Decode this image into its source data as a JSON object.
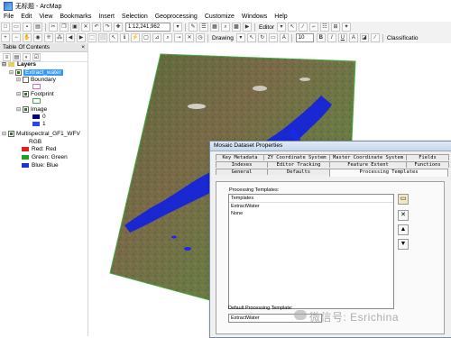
{
  "window": {
    "title": "无标题 - ArcMap"
  },
  "menu": [
    "File",
    "Edit",
    "View",
    "Bookmarks",
    "Insert",
    "Selection",
    "Geoprocessing",
    "Customize",
    "Windows",
    "Help"
  ],
  "toolbar": {
    "scale": "1:12,241,962",
    "editor_label": "Editor",
    "drawing_label": "Drawing",
    "font_size": "10",
    "bold": "B",
    "italic": "I",
    "underline": "U",
    "classification_label": "Classificatio"
  },
  "toc": {
    "title": "Table Of Contents",
    "close": "×",
    "root": "Layers",
    "layers": [
      {
        "label": "Extract_water",
        "selected": true
      },
      {
        "label": "Boundary"
      },
      {
        "label": "Footprint"
      },
      {
        "label": "Image"
      },
      {
        "label": "0"
      },
      {
        "label": "1"
      },
      {
        "label": "Multispectral_GF1_WFV"
      },
      {
        "label": "RGB"
      },
      {
        "label": "Red:  Red"
      },
      {
        "label": "Green: Green"
      },
      {
        "label": "Blue:  Blue"
      }
    ],
    "colors": {
      "boundary": "#d070d0",
      "footprint": "#40b040",
      "image0": "#000080",
      "image1": "#3040ff",
      "red": "#e02020",
      "green": "#20a020",
      "blue": "#2030e0"
    }
  },
  "dialog": {
    "title": "Mosaic Dataset Properties",
    "tabs_row1": [
      "Key Metadata",
      "ZY Coordinate System",
      "Master Coordinate System",
      "Fields"
    ],
    "tabs_row2": [
      "Indexes",
      "Editor Tracking",
      "Feature Extent",
      "Functions"
    ],
    "tabs_row3": [
      "General",
      "Defaults",
      "Processing Templates"
    ],
    "active_tab": "Processing Templates",
    "processing_templates_label": "Processing Templates:",
    "templates_header": "Templates",
    "templates": [
      "ExtractWater",
      "None"
    ],
    "default_template_label": "Default Processing Template:",
    "default_template_value": "ExtractWater"
  },
  "watermark": "微信号: Esrichina"
}
